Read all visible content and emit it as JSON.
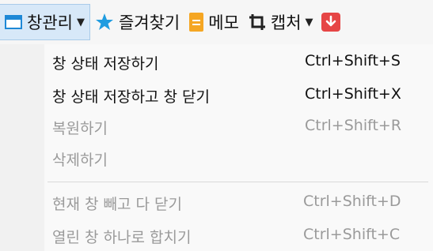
{
  "toolbar": {
    "window_mgmt": {
      "label": "창관리"
    },
    "favorites": {
      "label": "즐겨찾기"
    },
    "memo": {
      "label": "메모"
    },
    "capture": {
      "label": "캡처"
    }
  },
  "menu": {
    "items": [
      {
        "label": "창 상태 저장하기",
        "shortcut": "Ctrl+Shift+S",
        "enabled": true
      },
      {
        "label": "창 상태 저장하고 창 닫기",
        "shortcut": "Ctrl+Shift+X",
        "enabled": true
      },
      {
        "label": "복원하기",
        "shortcut": "Ctrl+Shift+R",
        "enabled": false
      },
      {
        "label": "삭제하기",
        "shortcut": "",
        "enabled": false
      },
      {
        "label": "현재 창 빼고 다 닫기",
        "shortcut": "Ctrl+Shift+D",
        "enabled": false
      },
      {
        "label": "열린 창 하나로 합치기",
        "shortcut": "Ctrl+Shift+C",
        "enabled": false
      }
    ]
  },
  "colors": {
    "accent_blue": "#1e88d6",
    "star_blue": "#1f9ce0",
    "memo_orange": "#f5a623",
    "download_red": "#e64545",
    "disabled_text": "#9a9a9a"
  }
}
